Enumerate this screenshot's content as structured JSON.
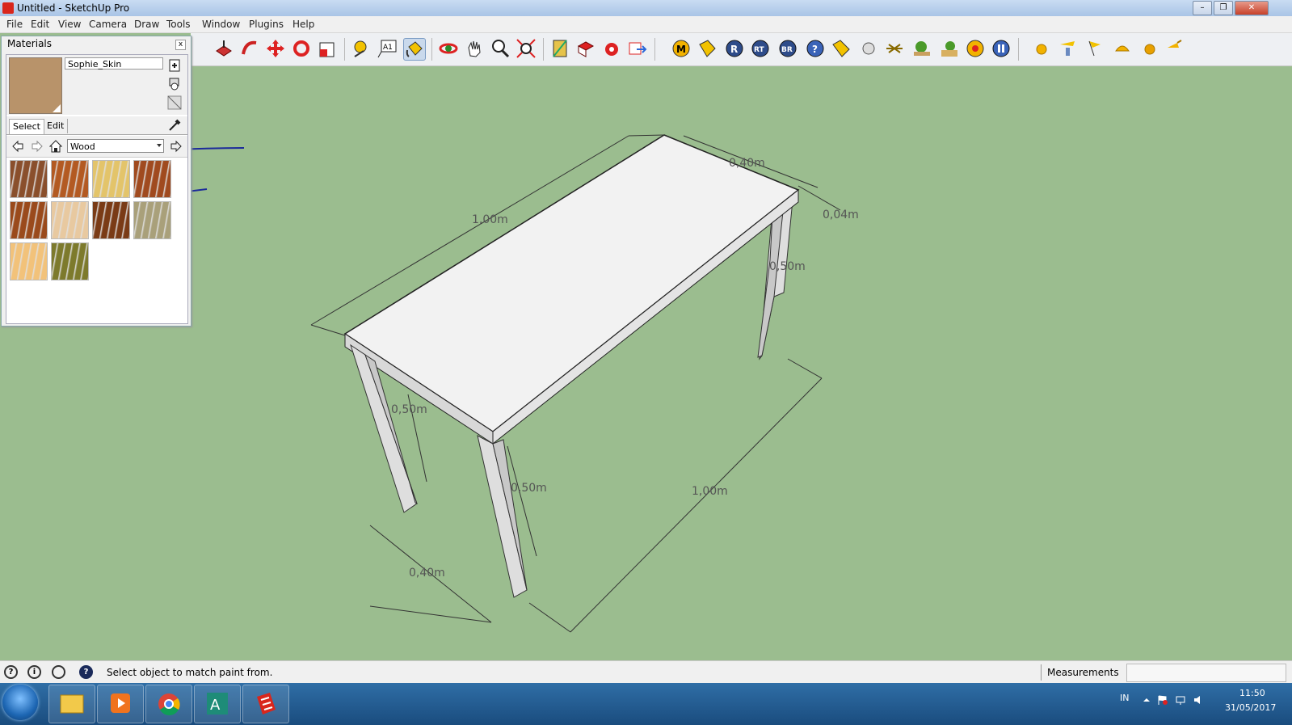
{
  "window": {
    "title": "Untitled - SketchUp Pro",
    "controls": [
      "–",
      "❐",
      "✕"
    ]
  },
  "menu": [
    "File",
    "Edit",
    "View",
    "Camera",
    "Draw",
    "Tools",
    "Window",
    "Plugins",
    "Help"
  ],
  "toolbar": {
    "tools": [
      "push-pull",
      "follow-me",
      "move",
      "rotate",
      "scale",
      "tape-measure",
      "text",
      "paint-bucket",
      "orbit",
      "pan",
      "zoom",
      "zoom-extents",
      "section-plane",
      "component",
      "warehouse",
      "share",
      "plugin-m",
      "plugin-tag",
      "plugin-r",
      "plugin-rt",
      "plugin-br",
      "plugin-help",
      "plugin-label",
      "plugin-sphere",
      "plugin-sun",
      "plugin-tree",
      "plugin-house",
      "plugin-target",
      "plugin-pause",
      "sphere-ball",
      "lamp",
      "flag",
      "dome",
      "ball-half",
      "watering"
    ],
    "icons": {
      "M": "M",
      "R": "R",
      "RT": "RT",
      "BR": "BR",
      "help": "?"
    }
  },
  "materials_panel": {
    "title": "Materials",
    "close_label": "x",
    "current_material": "Sophie_Skin",
    "current_color": "#b8936a",
    "tabs": {
      "select": "Select",
      "edit": "Edit"
    },
    "library": "Wood",
    "swatches": [
      "#8a4f2c",
      "#b35a22",
      "#e3c46a",
      "#a04a1f",
      "#9a4a1c",
      "#e8c9a0",
      "#7a3b16",
      "#a9a07a",
      "#f2c27a",
      "#7d7a2c"
    ]
  },
  "model": {
    "dimensions": [
      "1,00m",
      "0,40m",
      "0,04m",
      "0,50m",
      "0,50m",
      "0,50m",
      "1,00m",
      "0,40m"
    ],
    "annotation_color": "#1b2a9a"
  },
  "statusbar": {
    "message": "Select object to match paint from.",
    "measurements_label": "Measurements",
    "measurements_value": "",
    "icons": [
      "?",
      "i",
      "user",
      "?"
    ]
  },
  "taskbar": {
    "apps": [
      "explorer",
      "media-player",
      "chrome",
      "autocad",
      "sketchup"
    ],
    "lang": "IN",
    "time": "11:50",
    "date": "31/05/2017"
  }
}
